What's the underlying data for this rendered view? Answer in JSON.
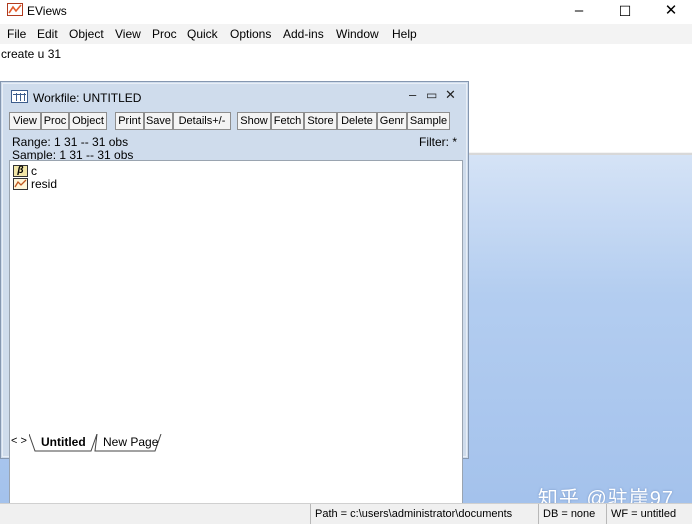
{
  "app": {
    "title": "EViews"
  },
  "window_controls": {
    "minimize": "–",
    "maximize": "☐",
    "close": "✕"
  },
  "menu": [
    "File",
    "Edit",
    "Object",
    "View",
    "Proc",
    "Quick",
    "Options",
    "Add-ins",
    "Window",
    "Help"
  ],
  "command": {
    "text": "create u 31"
  },
  "workfile": {
    "title": "Workfile: UNTITLED",
    "controls": {
      "minimize": "–",
      "maximize": "▭",
      "close": "✕"
    },
    "toolbar": [
      "View",
      "Proc",
      "Object",
      "Print",
      "Save",
      "Details+/-",
      "Show",
      "Fetch",
      "Store",
      "Delete",
      "Genr",
      "Sample"
    ],
    "range": "Range:  1 31  --  31 obs",
    "sample": "Sample: 1 31  --  31 obs",
    "filter": "Filter: *",
    "objects": [
      {
        "icon": "coef-icon",
        "glyph": "β",
        "name": "c"
      },
      {
        "icon": "series-icon",
        "glyph": "",
        "name": "resid"
      }
    ],
    "tab_nav": "< >",
    "tabs": [
      "Untitled",
      "New Page"
    ]
  },
  "watermark": "知乎 @驻崖97",
  "status": {
    "path": "Path = c:\\users\\administrator\\documents",
    "db": "DB = none",
    "wf": "WF = untitled"
  },
  "colors": {
    "desktop": "#a4c2ec",
    "window_frame": "#cfdcec",
    "accent": "#e35b2b"
  }
}
